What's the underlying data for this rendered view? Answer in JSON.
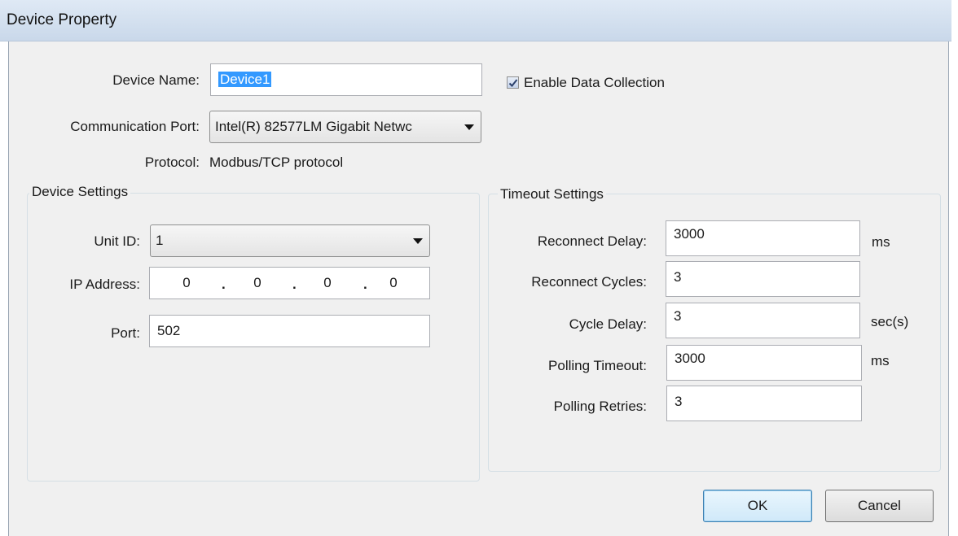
{
  "window": {
    "title": "Device Property"
  },
  "device": {
    "name_label": "Device Name:",
    "name_value": "Device1",
    "enable_label": "Enable Data Collection",
    "enable_checked": true,
    "port_label": "Communication Port:",
    "port_value": "Intel(R) 82577LM Gigabit Netwc",
    "protocol_label": "Protocol:",
    "protocol_value": "Modbus/TCP protocol"
  },
  "device_settings": {
    "title": "Device Settings",
    "unit_id_label": "Unit ID:",
    "unit_id_value": "1",
    "ip_label": "IP Address:",
    "ip_octets": [
      "0",
      "0",
      "0",
      "0"
    ],
    "port_label": "Port:",
    "port_value": "502"
  },
  "timeout_settings": {
    "title": "Timeout Settings",
    "reconnect_delay_label": "Reconnect Delay:",
    "reconnect_delay_value": "3000",
    "reconnect_delay_unit": "ms",
    "reconnect_cycles_label": "Reconnect Cycles:",
    "reconnect_cycles_value": "3",
    "cycle_delay_label": "Cycle Delay:",
    "cycle_delay_value": "3",
    "cycle_delay_unit": "sec(s)",
    "polling_timeout_label": "Polling Timeout:",
    "polling_timeout_value": "3000",
    "polling_timeout_unit": "ms",
    "polling_retries_label": "Polling Retries:",
    "polling_retries_value": "3"
  },
  "buttons": {
    "ok": "OK",
    "cancel": "Cancel"
  },
  "colors": {
    "selection": "#3399ff",
    "dialog_bg": "#f0f0f0",
    "titlebar": "#d6e3f2"
  }
}
